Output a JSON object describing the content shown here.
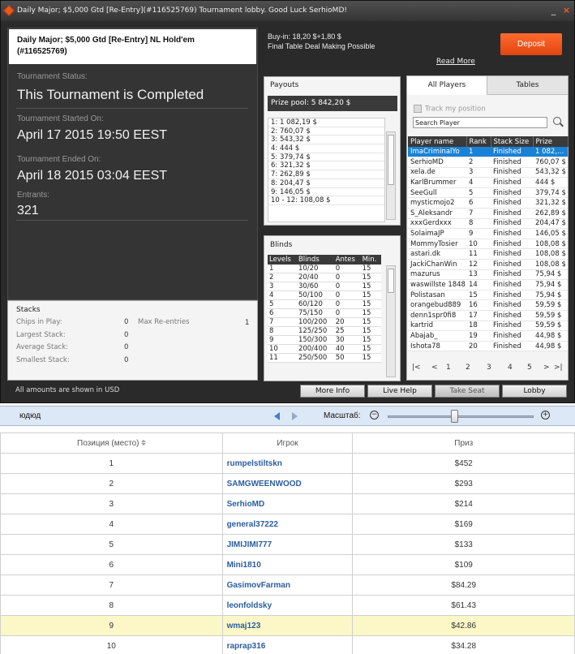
{
  "window": {
    "title": "Daily Major; $5,000 Gtd [Re-Entry](#116525769) Tournament lobby. Good Luck SerhioMD!",
    "minimize": "_",
    "close": "×"
  },
  "tournament": {
    "name": "Daily Major; $5,000 Gtd [Re-Entry] NL Hold'em",
    "id": "(#116525769)",
    "status_label": "Tournament Status:",
    "status": "This Tournament is Completed",
    "started_label": "Tournament Started On:",
    "started": "April 17 2015   19:50 EEST",
    "ended_label": "Tournament Ended On:",
    "ended": "April 18 2015   03:04 EEST",
    "entrants_label": "Entrants:",
    "entrants": "321"
  },
  "buyin": {
    "line1": "Buy-in: 18,20 $+1,80 $",
    "line2": "Final Table Deal Making Possible",
    "deposit": "Deposit",
    "read_more": "Read More"
  },
  "stacks": {
    "title": "Stacks",
    "chips_label": "Chips in Play:",
    "chips": "0",
    "max_reentries_label": "Max Re-entries",
    "max_reentries": "1",
    "largest_label": "Largest Stack:",
    "largest": "0",
    "average_label": "Average Stack:",
    "average": "0",
    "smallest_label": "Smallest Stack:",
    "smallest": "0"
  },
  "amounts_note": "All amounts are shown in USD",
  "payouts": {
    "title": "Payouts",
    "prize_pool": "Prize pool: 5 842,20 $",
    "rows": [
      "1: 1 082,19 $",
      "2: 760,07 $",
      "3: 543,32 $",
      "4: 444 $",
      "5: 379,74 $",
      "6: 321,32 $",
      "7: 262,89 $",
      "8: 204,47 $",
      "9: 146,05 $",
      "10 - 12: 108,08 $"
    ]
  },
  "blinds": {
    "title": "Blinds",
    "headers": [
      "Levels",
      "Blinds",
      "Antes",
      "Min."
    ],
    "rows": [
      [
        "1",
        "10/20",
        "0",
        "15"
      ],
      [
        "2",
        "20/40",
        "0",
        "15"
      ],
      [
        "3",
        "30/60",
        "0",
        "15"
      ],
      [
        "4",
        "50/100",
        "0",
        "15"
      ],
      [
        "5",
        "60/120",
        "0",
        "15"
      ],
      [
        "6",
        "75/150",
        "0",
        "15"
      ],
      [
        "7",
        "100/200",
        "20",
        "15"
      ],
      [
        "8",
        "125/250",
        "25",
        "15"
      ],
      [
        "9",
        "150/300",
        "30",
        "15"
      ],
      [
        "10",
        "200/400",
        "40",
        "15"
      ],
      [
        "11",
        "250/500",
        "50",
        "15"
      ]
    ]
  },
  "players": {
    "tab_all": "All Players",
    "tab_tables": "Tables",
    "track_label": "Track my position",
    "search_placeholder": "Search Player",
    "headers": [
      "Player name",
      "Rank",
      "Stack Size",
      "Prize"
    ],
    "rows": [
      [
        "ImaCriminalYo",
        "1",
        "Finished",
        "1 082,..."
      ],
      [
        "SerhioMD",
        "2",
        "Finished",
        "760,07 $"
      ],
      [
        "xela.de",
        "3",
        "Finished",
        "543,32 $"
      ],
      [
        "KarlBrummer",
        "4",
        "Finished",
        "444 $"
      ],
      [
        "SeeGull",
        "5",
        "Finished",
        "379,74 $"
      ],
      [
        "mysticmojo2",
        "6",
        "Finished",
        "321,32 $"
      ],
      [
        "S_Aleksandr",
        "7",
        "Finished",
        "262,89 $"
      ],
      [
        "xxxGerdxxx",
        "8",
        "Finished",
        "204,47 $"
      ],
      [
        "SolaimaJP",
        "9",
        "Finished",
        "146,05 $"
      ],
      [
        "MommyTosier",
        "10",
        "Finished",
        "108,08 $"
      ],
      [
        "astari.dk",
        "11",
        "Finished",
        "108,08 $"
      ],
      [
        "JackiChanWin",
        "12",
        "Finished",
        "108,08 $"
      ],
      [
        "mazurus",
        "13",
        "Finished",
        "75,94 $"
      ],
      [
        "waswillste 1848",
        "14",
        "Finished",
        "75,94 $"
      ],
      [
        "Polistasan",
        "15",
        "Finished",
        "75,94 $"
      ],
      [
        "orangebud889",
        "16",
        "Finished",
        "59,59 $"
      ],
      [
        "denn1spr0fi8",
        "17",
        "Finished",
        "59,59 $"
      ],
      [
        "kartrid",
        "18",
        "Finished",
        "59,59 $"
      ],
      [
        "Abajab_",
        "19",
        "Finished",
        "44,98 $"
      ],
      [
        "Ishota78",
        "20",
        "Finished",
        "44,98 $"
      ]
    ],
    "pager": {
      "first": "|<",
      "prev": "<",
      "pages": [
        "1",
        "2",
        "3",
        "4",
        "5"
      ],
      "next": ">",
      "last": ">|"
    }
  },
  "buttons": {
    "more_info": "More Info",
    "live_help": "Live Help",
    "take_seat": "Take Seat",
    "lobby": "Lobby"
  },
  "zoombar": {
    "left_label": "юдюд",
    "scale_label": "Масштаб:",
    "zoom_out": "−",
    "zoom_in": "+",
    "zoom_level": 0.55
  },
  "ranking": {
    "headers": [
      "Позиция (место)",
      "Игрок",
      "Приз"
    ],
    "rows": [
      [
        "1",
        "rumpelstiltskn",
        "$452"
      ],
      [
        "2",
        "SAMGWEENWOOD",
        "$293"
      ],
      [
        "3",
        "SerhioMD",
        "$214"
      ],
      [
        "4",
        "general37222",
        "$169"
      ],
      [
        "5",
        "JIMIJIMI777",
        "$133"
      ],
      [
        "6",
        "Mini1810",
        "$109"
      ],
      [
        "7",
        "GasimovFarman",
        "$84.29"
      ],
      [
        "8",
        "leonfoldsky",
        "$61.43"
      ],
      [
        "9",
        "wmaj123",
        "$42.86"
      ],
      [
        "10",
        "raprap316",
        "$34.28"
      ]
    ],
    "highlight_row": 9
  },
  "colors": {
    "accent": "#ff6a30",
    "selected_row": "#1a82d6",
    "highlight_row": "#fbf7c6",
    "link": "#2b5d9e"
  }
}
